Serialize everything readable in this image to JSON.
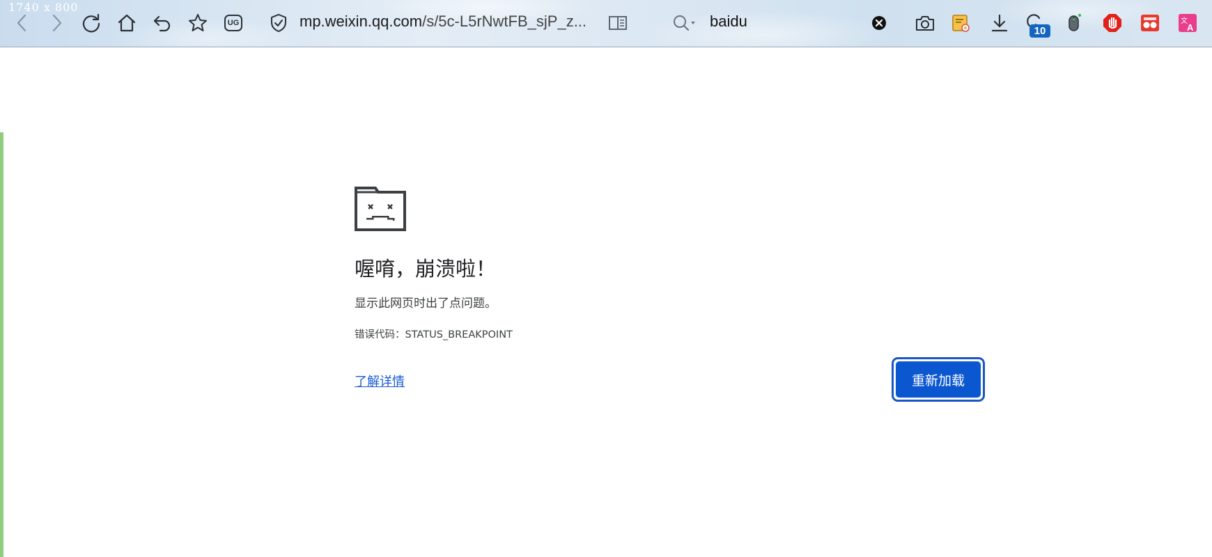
{
  "screenshot_label": "1740 x 800",
  "toolbar": {
    "url_host": "mp.weixin.qq.com",
    "url_path": "/s/5c-L5rNwtFB_sjP_z...",
    "search_query": "baidu",
    "extension_badge": "10",
    "icons": [
      "back-icon",
      "forward-icon",
      "reload-icon",
      "home-icon",
      "undo-icon",
      "star-icon",
      "ug-icon",
      "shield-icon",
      "reader-icon",
      "search-icon",
      "clear-icon",
      "camera-icon",
      "notes-icon",
      "download-icon",
      "sync-icon",
      "mouse-icon",
      "adblock-icon",
      "extension-red-icon",
      "translate-icon"
    ],
    "ug_label": "UG"
  },
  "error_page": {
    "title": "喔唷，崩溃啦！",
    "subtitle": "显示此网页时出了点问题。",
    "error_code": "错误代码：STATUS_BREAKPOINT",
    "learn_more": "了解详情",
    "reload_button": "重新加载"
  },
  "colors": {
    "primary_button": "#0b57d0",
    "link": "#1a5bd6",
    "adblock": "#e0201b",
    "translate": "#e83e8c"
  }
}
